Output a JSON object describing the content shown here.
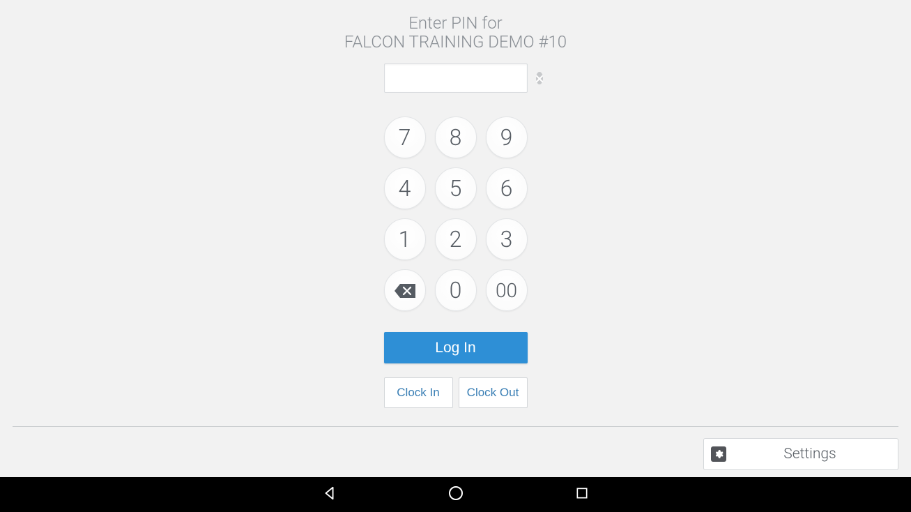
{
  "header": {
    "line1": "Enter PIN for",
    "line2": "FALCON TRAINING DEMO #10"
  },
  "pin_input": {
    "value": "",
    "placeholder": ""
  },
  "keypad": {
    "keys": [
      "7",
      "8",
      "9",
      "4",
      "5",
      "6",
      "1",
      "2",
      "3"
    ],
    "zero": "0",
    "double_zero": "00",
    "backspace_icon": "backspace-icon"
  },
  "actions": {
    "login": "Log In",
    "clock_in": "Clock In",
    "clock_out": "Clock Out"
  },
  "settings": {
    "label": "Settings",
    "icon": "gear-icon"
  },
  "nav": {
    "back": "back-icon",
    "home": "home-icon",
    "recents": "recents-icon"
  },
  "colors": {
    "primary": "#2e8fd6",
    "text_muted": "#8a8f95",
    "key_text": "#555b62"
  }
}
